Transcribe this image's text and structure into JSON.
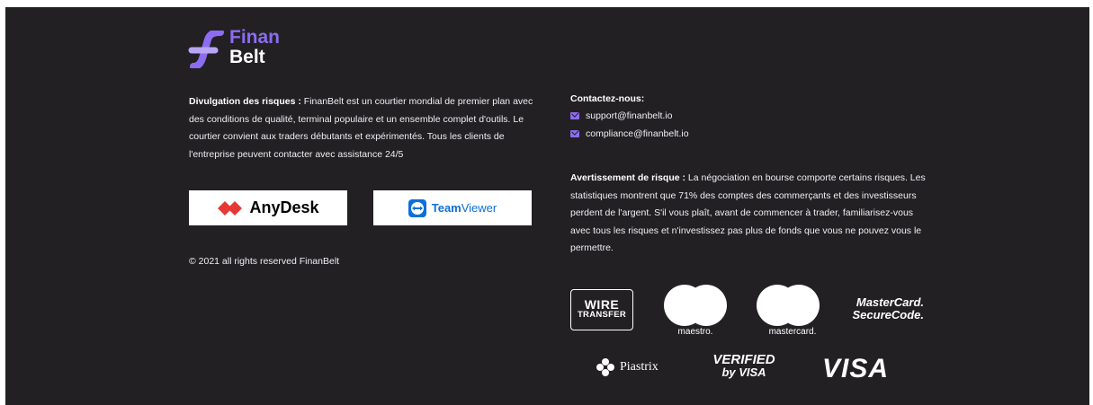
{
  "brand": {
    "word1": "Finan",
    "word2": "Belt",
    "accent": "#8c6cf0"
  },
  "risk_disclosure": {
    "title": "Divulgation des risques :",
    "text": " FinanBelt est un courtier mondial de premier plan avec des conditions de qualité, terminal populaire et un ensemble complet d'outils. Le courtier convient aux traders débutants et expérimentés. Tous les clients de l'entreprise peuvent contacter avec assistance 24/5"
  },
  "remote_tools": {
    "anydesk": {
      "label": "AnyDesk",
      "icon": "anydesk-diamond-icon"
    },
    "teamviewer": {
      "label_team": "Team",
      "label_viewer": "Viewer",
      "icon": "teamviewer-icon"
    }
  },
  "copyright": "© 2021 all rights reserved FinanBelt",
  "contact": {
    "title": "Contactez-nous:",
    "emails": [
      "support@finanbelt.io",
      "compliance@finanbelt.io"
    ]
  },
  "warning": {
    "title": "Avertissement de risque :",
    "text": " La négociation en bourse comporte certains risques. Les statistiques montrent que 71% des comptes des commerçants et des investisseurs perdent de l'argent. S'il vous plaît, avant de commencer à trader, familiarisez-vous avec tous les risques et n'investissez pas plus de fonds que vous ne pouvez vous le permettre."
  },
  "payments": {
    "wire_line1": "WIRE",
    "wire_line2": "TRANSFER",
    "maestro": "maestro.",
    "mastercard": "mastercard.",
    "securecode_line1": "MasterCard.",
    "securecode_line2": "SecureCode.",
    "piastrix": "Piastrix",
    "verified_line1": "VERIFIED",
    "verified_line2": "by VISA",
    "visa": "VISA"
  }
}
